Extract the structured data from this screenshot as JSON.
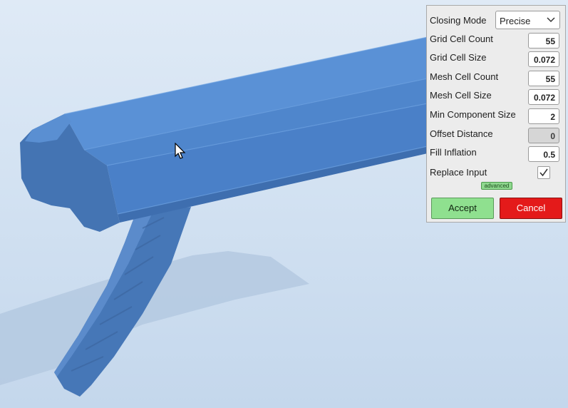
{
  "panel": {
    "closing_mode": {
      "label": "Closing Mode",
      "value": "Precise"
    },
    "fields": [
      {
        "label": "Grid Cell Count",
        "value": "55",
        "disabled": false
      },
      {
        "label": "Grid Cell Size",
        "value": "0.072",
        "disabled": false
      },
      {
        "label": "Mesh Cell Count",
        "value": "55",
        "disabled": false
      },
      {
        "label": "Mesh Cell Size",
        "value": "0.072",
        "disabled": false
      },
      {
        "label": "Min Component Size",
        "value": "2",
        "disabled": false
      },
      {
        "label": "Offset Distance",
        "value": "0",
        "disabled": true
      },
      {
        "label": "Fill Inflation",
        "value": "0.5",
        "disabled": false
      }
    ],
    "replace_input": {
      "label": "Replace Input",
      "checked": true
    },
    "advanced_label": "advanced",
    "accept_label": "Accept",
    "cancel_label": "Cancel"
  },
  "colors": {
    "mesh": "#4a80c8",
    "accept": "#8fe08f",
    "cancel": "#e41a1a",
    "background": "#d3e2f2"
  },
  "icons": [
    "chevron-down-icon",
    "checkmark-icon",
    "mouse-cursor-icon"
  ]
}
